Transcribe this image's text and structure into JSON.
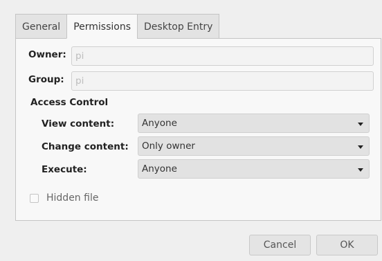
{
  "tabs": [
    {
      "label": "General"
    },
    {
      "label": "Permissions"
    },
    {
      "label": "Desktop Entry"
    }
  ],
  "ownership": {
    "owner_label": "Owner:",
    "owner_value": "pi",
    "group_label": "Group:",
    "group_value": "pi"
  },
  "access": {
    "title": "Access Control",
    "view_label": "View content:",
    "view_value": "Anyone",
    "change_label": "Change content:",
    "change_value": "Only owner",
    "execute_label": "Execute:",
    "execute_value": "Anyone"
  },
  "hidden_file": {
    "label": "Hidden file",
    "checked": false
  },
  "buttons": {
    "cancel": "Cancel",
    "ok": "OK"
  }
}
